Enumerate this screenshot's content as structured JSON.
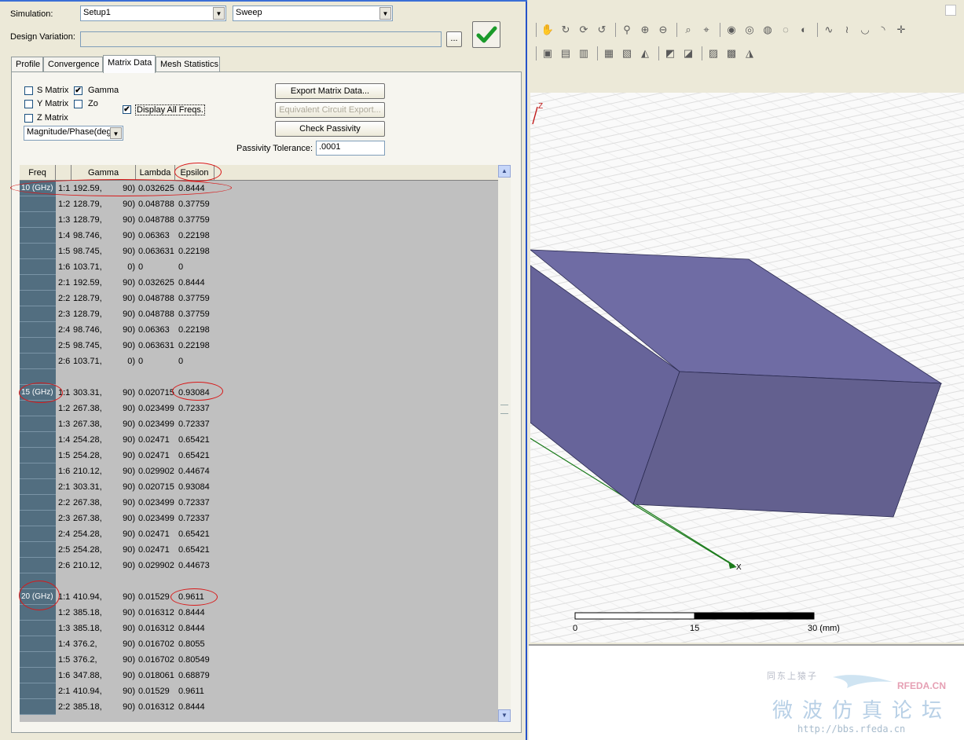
{
  "simulation": {
    "label": "Simulation:",
    "setup": "Setup1",
    "sweep": "Sweep"
  },
  "design_variation": {
    "label": "Design Variation:",
    "value": "",
    "browse_label": "...",
    "apply_icon": "checkmark-icon"
  },
  "tabs": [
    "Profile",
    "Convergence",
    "Matrix Data",
    "Mesh Statistics"
  ],
  "active_tab": "Matrix Data",
  "options": {
    "s_matrix": {
      "label": "S Matrix",
      "checked": false
    },
    "y_matrix": {
      "label": "Y Matrix",
      "checked": false
    },
    "z_matrix": {
      "label": "Z Matrix",
      "checked": false
    },
    "gamma": {
      "label": "Gamma",
      "checked": true
    },
    "zo": {
      "label": "Zo",
      "checked": false
    },
    "display_all_freqs": {
      "label": "Display All Freqs.",
      "checked": true
    },
    "format": "Magnitude/Phase(deg"
  },
  "buttons": {
    "export": "Export Matrix Data...",
    "equivalent": "Equivalent Circuit Export...",
    "passivity": "Check Passivity"
  },
  "passivity_tolerance": {
    "label": "Passivity Tolerance:",
    "value": ".0001"
  },
  "grid": {
    "columns": [
      "Freq",
      "Gamma",
      "Lambda",
      "Epsilon"
    ],
    "rows": [
      {
        "freq": "10 (GHz)",
        "entry": "1:1",
        "gamma_mag": "192.59,",
        "gamma_phase": "90)",
        "lambda": "0.032625",
        "epsilon": "0.8444"
      },
      {
        "freq": "",
        "entry": "1:2",
        "gamma_mag": "128.79,",
        "gamma_phase": "90)",
        "lambda": "0.048788",
        "epsilon": "0.37759"
      },
      {
        "freq": "",
        "entry": "1:3",
        "gamma_mag": "128.79,",
        "gamma_phase": "90)",
        "lambda": "0.048788",
        "epsilon": "0.37759"
      },
      {
        "freq": "",
        "entry": "1:4",
        "gamma_mag": "98.746,",
        "gamma_phase": "90)",
        "lambda": "0.06363",
        "epsilon": "0.22198"
      },
      {
        "freq": "",
        "entry": "1:5",
        "gamma_mag": "98.745,",
        "gamma_phase": "90)",
        "lambda": "0.063631",
        "epsilon": "0.22198"
      },
      {
        "freq": "",
        "entry": "1:6",
        "gamma_mag": "103.71,",
        "gamma_phase": "0)",
        "lambda": "0",
        "epsilon": "0"
      },
      {
        "freq": "",
        "entry": "2:1",
        "gamma_mag": "192.59,",
        "gamma_phase": "90)",
        "lambda": "0.032625",
        "epsilon": "0.8444"
      },
      {
        "freq": "",
        "entry": "2:2",
        "gamma_mag": "128.79,",
        "gamma_phase": "90)",
        "lambda": "0.048788",
        "epsilon": "0.37759"
      },
      {
        "freq": "",
        "entry": "2:3",
        "gamma_mag": "128.79,",
        "gamma_phase": "90)",
        "lambda": "0.048788",
        "epsilon": "0.37759"
      },
      {
        "freq": "",
        "entry": "2:4",
        "gamma_mag": "98.746,",
        "gamma_phase": "90)",
        "lambda": "0.06363",
        "epsilon": "0.22198"
      },
      {
        "freq": "",
        "entry": "2:5",
        "gamma_mag": "98.745,",
        "gamma_phase": "90)",
        "lambda": "0.063631",
        "epsilon": "0.22198"
      },
      {
        "freq": "",
        "entry": "2:6",
        "gamma_mag": "103.71,",
        "gamma_phase": "0)",
        "lambda": "0",
        "epsilon": "0"
      },
      {
        "freq": "",
        "entry": "",
        "gamma_mag": "",
        "gamma_phase": "",
        "lambda": "",
        "epsilon": ""
      },
      {
        "freq": "15 (GHz)",
        "entry": "1:1",
        "gamma_mag": "303.31,",
        "gamma_phase": "90)",
        "lambda": "0.020715",
        "epsilon": "0.93084"
      },
      {
        "freq": "",
        "entry": "1:2",
        "gamma_mag": "267.38,",
        "gamma_phase": "90)",
        "lambda": "0.023499",
        "epsilon": "0.72337"
      },
      {
        "freq": "",
        "entry": "1:3",
        "gamma_mag": "267.38,",
        "gamma_phase": "90)",
        "lambda": "0.023499",
        "epsilon": "0.72337"
      },
      {
        "freq": "",
        "entry": "1:4",
        "gamma_mag": "254.28,",
        "gamma_phase": "90)",
        "lambda": "0.02471",
        "epsilon": "0.65421"
      },
      {
        "freq": "",
        "entry": "1:5",
        "gamma_mag": "254.28,",
        "gamma_phase": "90)",
        "lambda": "0.02471",
        "epsilon": "0.65421"
      },
      {
        "freq": "",
        "entry": "1:6",
        "gamma_mag": "210.12,",
        "gamma_phase": "90)",
        "lambda": "0.029902",
        "epsilon": "0.44674"
      },
      {
        "freq": "",
        "entry": "2:1",
        "gamma_mag": "303.31,",
        "gamma_phase": "90)",
        "lambda": "0.020715",
        "epsilon": "0.93084"
      },
      {
        "freq": "",
        "entry": "2:2",
        "gamma_mag": "267.38,",
        "gamma_phase": "90)",
        "lambda": "0.023499",
        "epsilon": "0.72337"
      },
      {
        "freq": "",
        "entry": "2:3",
        "gamma_mag": "267.38,",
        "gamma_phase": "90)",
        "lambda": "0.023499",
        "epsilon": "0.72337"
      },
      {
        "freq": "",
        "entry": "2:4",
        "gamma_mag": "254.28,",
        "gamma_phase": "90)",
        "lambda": "0.02471",
        "epsilon": "0.65421"
      },
      {
        "freq": "",
        "entry": "2:5",
        "gamma_mag": "254.28,",
        "gamma_phase": "90)",
        "lambda": "0.02471",
        "epsilon": "0.65421"
      },
      {
        "freq": "",
        "entry": "2:6",
        "gamma_mag": "210.12,",
        "gamma_phase": "90)",
        "lambda": "0.029902",
        "epsilon": "0.44673"
      },
      {
        "freq": "",
        "entry": "",
        "gamma_mag": "",
        "gamma_phase": "",
        "lambda": "",
        "epsilon": ""
      },
      {
        "freq": "20 (GHz)",
        "entry": "1:1",
        "gamma_mag": "410.94,",
        "gamma_phase": "90)",
        "lambda": "0.01529",
        "epsilon": "0.9611"
      },
      {
        "freq": "",
        "entry": "1:2",
        "gamma_mag": "385.18,",
        "gamma_phase": "90)",
        "lambda": "0.016312",
        "epsilon": "0.8444"
      },
      {
        "freq": "",
        "entry": "1:3",
        "gamma_mag": "385.18,",
        "gamma_phase": "90)",
        "lambda": "0.016312",
        "epsilon": "0.8444"
      },
      {
        "freq": "",
        "entry": "1:4",
        "gamma_mag": "376.2,",
        "gamma_phase": "90)",
        "lambda": "0.016702",
        "epsilon": "0.8055"
      },
      {
        "freq": "",
        "entry": "1:5",
        "gamma_mag": "376.2,",
        "gamma_phase": "90)",
        "lambda": "0.016702",
        "epsilon": "0.80549"
      },
      {
        "freq": "",
        "entry": "1:6",
        "gamma_mag": "347.88,",
        "gamma_phase": "90)",
        "lambda": "0.018061",
        "epsilon": "0.68879"
      },
      {
        "freq": "",
        "entry": "2:1",
        "gamma_mag": "410.94,",
        "gamma_phase": "90)",
        "lambda": "0.01529",
        "epsilon": "0.9611"
      },
      {
        "freq": "",
        "entry": "2:2",
        "gamma_mag": "385.18,",
        "gamma_phase": "90)",
        "lambda": "0.016312",
        "epsilon": "0.8444"
      }
    ]
  },
  "viewer": {
    "axis_labels": {
      "z": "Z",
      "x": "X"
    },
    "scale_bar": {
      "ticks": [
        "0",
        "15",
        "30 (mm)"
      ]
    },
    "toolbar_row1": [
      "pan-icon",
      "rotate-icon",
      "rotate-axis-icon",
      "orbit-icon",
      "zoom-icon",
      "zoom-in-icon",
      "zoom-out-icon",
      "zoom-fit-icon",
      "zoom-selection-icon",
      "show-icon",
      "hide-icon",
      "hide-all-icon",
      "show-all-icon",
      "hide-selected-icon",
      "curve-icon",
      "spline-icon",
      "arc-icon",
      "half-arc-icon",
      "point-icon"
    ],
    "toolbar_row2": [
      "unite-icon",
      "subtract-icon",
      "intersect-icon",
      "split-icon",
      "separate-icon",
      "mirror-icon",
      "sweep-icon",
      "cover-icon",
      "align-icon",
      "duplicate-icon",
      "mirror-duplicate-icon"
    ]
  },
  "watermark": {
    "line1": "同东上猿子",
    "brand": "RFEDA.CN",
    "title": "微波仿真论坛",
    "url": "http://bbs.rfeda.cn"
  },
  "colors": {
    "accent": "#2552c8",
    "freq_cell": "#526e80",
    "solid_top": "#6f6ca4",
    "solid_front": "#63608f",
    "annotation": "#d81818"
  }
}
